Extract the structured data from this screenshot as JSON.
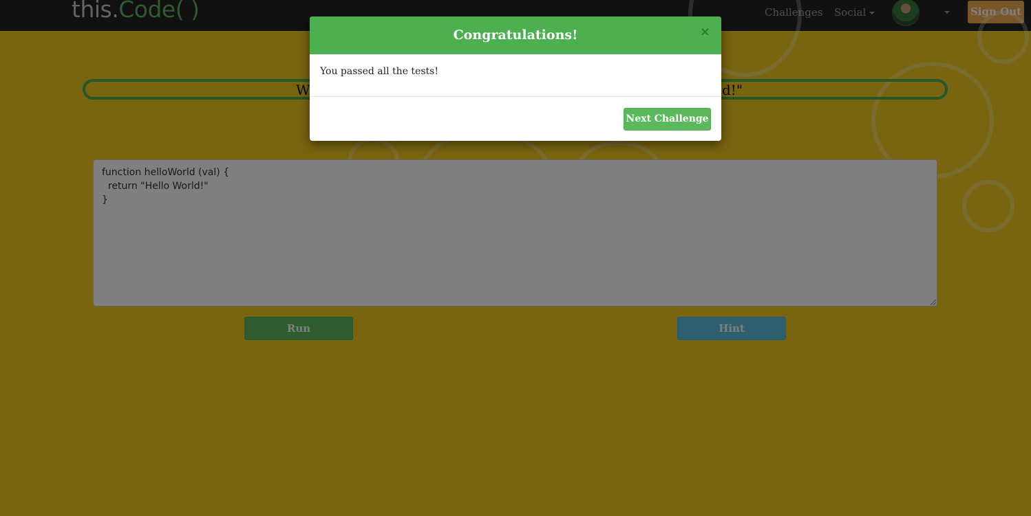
{
  "navbar": {
    "brand_prefix": "this.",
    "brand_suffix": "Code( )",
    "challenges_label": "Challenges",
    "social_label": "Social",
    "signout_label": "Sign Out"
  },
  "challenge": {
    "description_visible_left": "W",
    "description_visible_right": "d!\""
  },
  "editor": {
    "code": "function helloWorld (val) {\n  return \"Hello World!\"\n}"
  },
  "buttons": {
    "run_label": "Run",
    "hint_label": "Hint"
  },
  "modal": {
    "title": "Congratulations!",
    "close_symbol": "×",
    "message": "You passed all the tests!",
    "next_label": "Next Challenge"
  },
  "colors": {
    "page_background": "#f2c81f",
    "brand_green": "#5cb85c",
    "modal_header": "#4caf50",
    "hint_blue": "#5bc0de",
    "signout_orange": "#f0ad4e"
  },
  "icons": [
    "social-dropdown-caret",
    "avatar-dropdown-caret",
    "close-icon",
    "resize-grip-icon"
  ]
}
